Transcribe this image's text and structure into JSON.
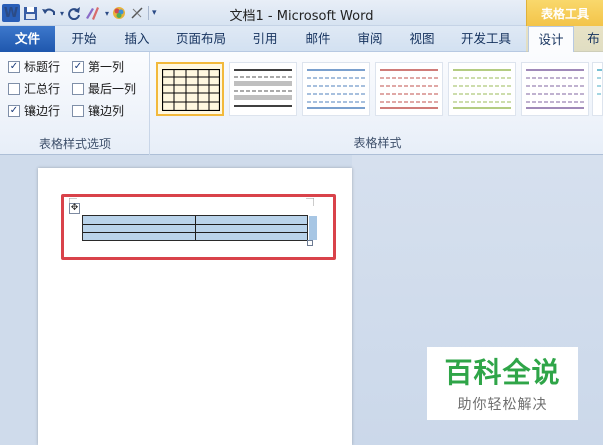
{
  "window": {
    "title": "文档1 - Microsoft Word",
    "context_tab_group": "表格工具",
    "app_logo": "W"
  },
  "quick_access": {
    "icons": [
      "word-logo-icon",
      "save-icon",
      "undo-icon",
      "redo-icon",
      "format-painter-icon",
      "color-icon",
      "clear-format-icon",
      "customize-qat-icon"
    ]
  },
  "tabs": [
    {
      "label": "文件"
    },
    {
      "label": "开始"
    },
    {
      "label": "插入"
    },
    {
      "label": "页面布局"
    },
    {
      "label": "引用"
    },
    {
      "label": "邮件"
    },
    {
      "label": "审阅"
    },
    {
      "label": "视图"
    },
    {
      "label": "开发工具"
    },
    {
      "label": "设计"
    },
    {
      "label": "布"
    }
  ],
  "ribbon": {
    "style_options": {
      "group_label": "表格样式选项",
      "items": [
        {
          "label": "标题行",
          "checked": true
        },
        {
          "label": "第一列",
          "checked": true
        },
        {
          "label": "汇总行",
          "checked": false
        },
        {
          "label": "最后一列",
          "checked": false
        },
        {
          "label": "镶边行",
          "checked": true
        },
        {
          "label": "镶边列",
          "checked": false
        }
      ]
    },
    "table_styles": {
      "group_label": "表格样式",
      "swatch_colors": [
        "#000000",
        "#555555",
        "#4f81bd",
        "#c0504d",
        "#9bbb59",
        "#8064a2",
        "#4bacc6"
      ]
    }
  },
  "document": {
    "table_rows": 3,
    "table_cols": 2,
    "cell_fill": "#b9d3ea"
  },
  "watermark": {
    "title": "百科全说",
    "subtitle": "助你轻松解决"
  }
}
